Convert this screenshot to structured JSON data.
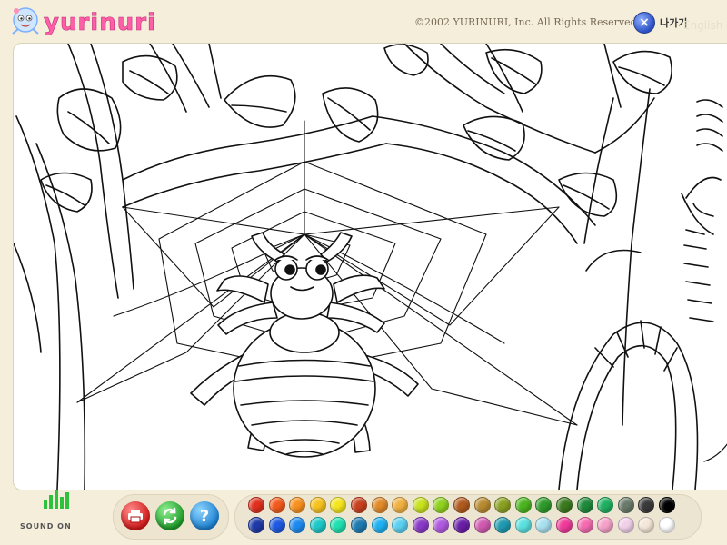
{
  "header": {
    "logo_text": "yurinuri",
    "copyright": "©2002 YURINURI, Inc. All Rights Reserved.",
    "exit_label": "나가기",
    "exit_icon": "x-icon",
    "exit_ghost": "English"
  },
  "sound": {
    "label": "SOUND ON",
    "color": "#2ec23c",
    "levels": [
      0.45,
      0.7,
      0.95,
      0.6,
      0.8
    ]
  },
  "tools": [
    {
      "name": "print-icon",
      "color": "#d11a1a"
    },
    {
      "name": "refresh-icon",
      "color": "#1f9a2a"
    },
    {
      "name": "help-icon",
      "color": "#1c7fcf",
      "symbol": "?"
    }
  ],
  "palette": {
    "row1": [
      "#e0301e",
      "#f25a1c",
      "#f7901e",
      "#f7c21e",
      "#f5e51e",
      "#c8401e",
      "#e08a2a",
      "#f0b040",
      "#c8e21e",
      "#8fd21e",
      "#b05a1e",
      "#b88a30",
      "#8aa020",
      "#4ab51e",
      "#2e9a2a",
      "#3a7a1e",
      "#1e8a3a",
      "#1eb060",
      "#6a7a6a",
      "#3a3a3a",
      "#000000"
    ],
    "row2": [
      "#1e3aa8",
      "#1e5ae0",
      "#1e8af0",
      "#1ec8c8",
      "#1ee0b0",
      "#1e7ab0",
      "#1eb0f0",
      "#5ad0f0",
      "#8a3ac8",
      "#b05ae0",
      "#6a1ea8",
      "#d05ab0",
      "#1e9ab0",
      "#5ae0e0",
      "#a8e0f0",
      "#f03a9a",
      "#f56ab0",
      "#f5a0c8",
      "#f0d0e8",
      "#f5e6d8",
      "#ffffff"
    ]
  }
}
